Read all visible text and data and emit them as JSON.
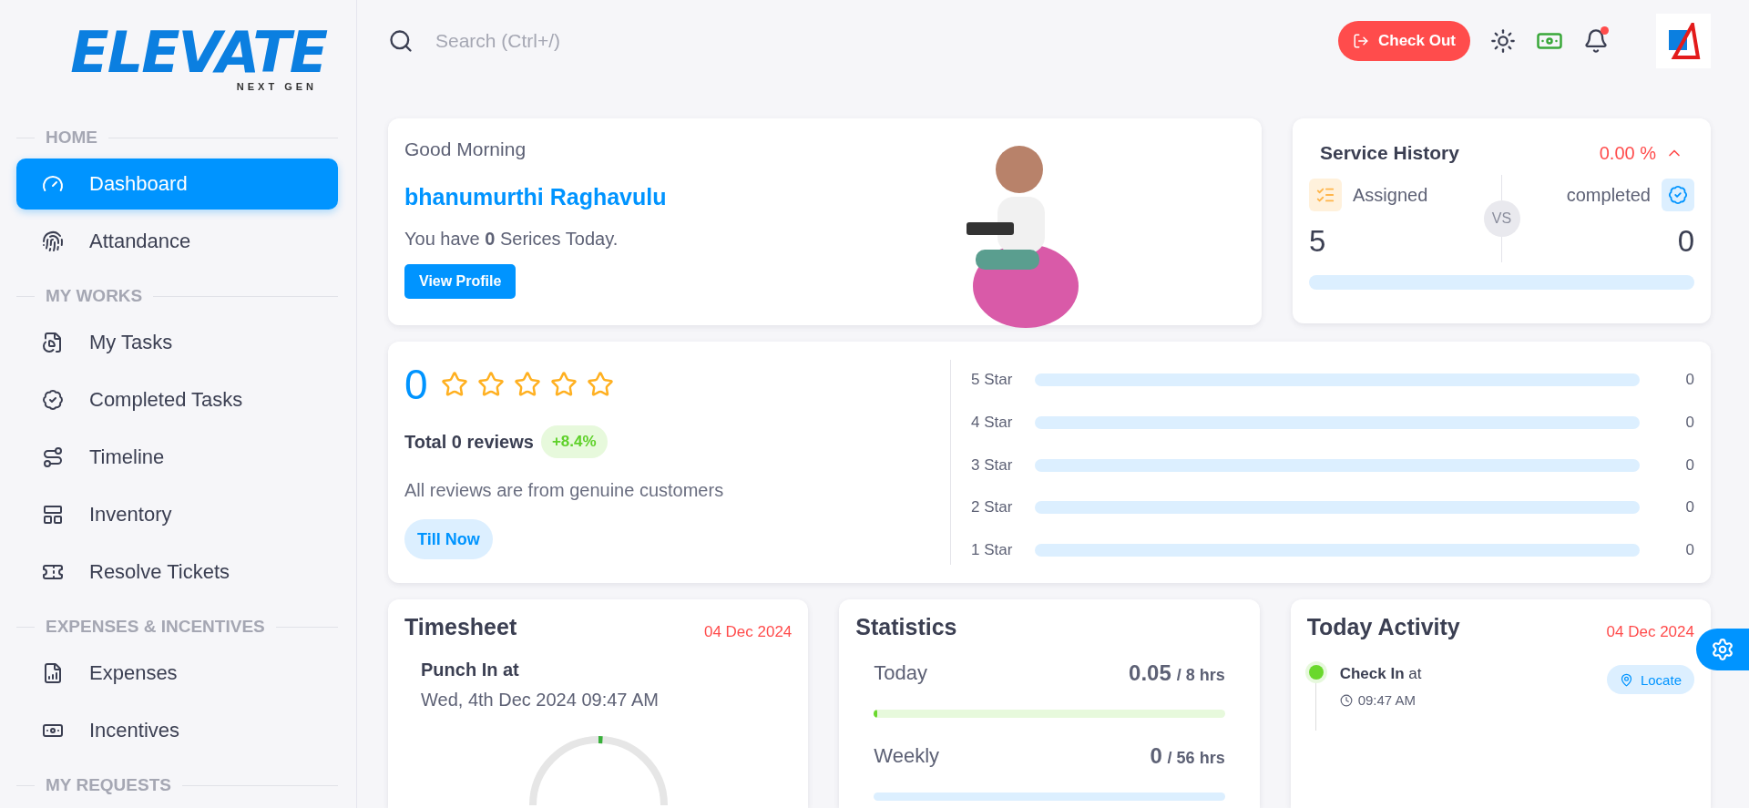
{
  "logo": {
    "word": "ELEVATE",
    "tagline": "NEXT GEN"
  },
  "sidebar": {
    "sections": [
      {
        "title": "HOME",
        "items": [
          {
            "label": "Dashboard",
            "selected": true
          },
          {
            "label": "Attandance",
            "selected": false
          }
        ]
      },
      {
        "title": "MY WORKS",
        "items": [
          {
            "label": "My Tasks",
            "selected": false
          },
          {
            "label": "Completed Tasks",
            "selected": false
          },
          {
            "label": "Timeline",
            "selected": false
          },
          {
            "label": "Inventory",
            "selected": false
          },
          {
            "label": "Resolve Tickets",
            "selected": false
          }
        ]
      },
      {
        "title": "EXPENSES & INCENTIVES",
        "items": [
          {
            "label": "Expenses",
            "selected": false
          },
          {
            "label": "Incentives",
            "selected": false
          }
        ]
      },
      {
        "title": "MY REQUESTS"
      }
    ]
  },
  "topbar": {
    "search": {
      "placeholder": "Search (Ctrl+/)"
    },
    "checkout": "Check Out"
  },
  "welcome": {
    "greeting": "Good Morning",
    "name": "bhanumurthi Raghavulu",
    "message": "You have **0** Serices Today.",
    "button": "View Profile"
  },
  "service_history": {
    "title": "Service History",
    "change": "0.00 %",
    "assigned_label": "Assigned",
    "completed_label": "completed",
    "vs": "VS",
    "assigned": "5",
    "completed": "0",
    "level": 0
  },
  "reviews": {
    "score": "0",
    "stars": 0,
    "total": "Total 0 reviews",
    "growth": "+8.4%",
    "note": "All reviews are from genuine customers",
    "button": "Till Now",
    "breakdown": [
      {
        "label": "5 Star",
        "count": "0",
        "level": 0
      },
      {
        "label": "4 Star",
        "count": "0",
        "level": 0
      },
      {
        "label": "3 Star",
        "count": "0",
        "level": 0
      },
      {
        "label": "2 Star",
        "count": "0",
        "level": 0
      },
      {
        "label": "1 Star",
        "count": "0",
        "level": 0
      }
    ]
  },
  "timesheet": {
    "title": "Timesheet",
    "date": "04 Dec 2024",
    "punch_label": "Punch In at",
    "punch_time": "Wed, 4th Dec 2024 09:47 AM",
    "level": 0.01
  },
  "statistics": {
    "title": "Statistics",
    "rows": [
      {
        "label": "Today",
        "value": "0.05",
        "total": "/ 8 hrs",
        "level": 0.01
      },
      {
        "label": "Weekly",
        "value": "0",
        "total": "/ 56 hrs",
        "level": 0
      }
    ]
  },
  "activity": {
    "title": "Today Activity",
    "date": "04 Dec 2024",
    "items": [
      {
        "text": "**Check In** at",
        "time": "09:47 AM",
        "button": "Locate",
        "color": "#6ad82c"
      }
    ]
  }
}
